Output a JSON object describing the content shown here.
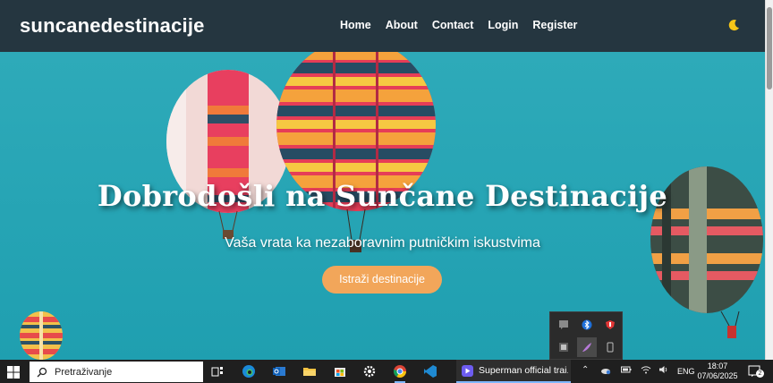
{
  "navbar": {
    "brand": "suncanedestinacije",
    "links": [
      "Home",
      "About",
      "Contact",
      "Login",
      "Register"
    ],
    "theme_icon": "moon-icon"
  },
  "hero": {
    "title": "Dobrodošli na Sunčane Destinacije",
    "subtitle": "Vaša vrata ka nezaboravnim putničkim iskustvima",
    "cta_label": "Istraži destinacije",
    "bg_color": "#2aa7b8",
    "cta_color": "#f2a65a"
  },
  "tray_flyout": {
    "icons": [
      "chat-icon",
      "bluetooth-icon",
      "shield-icon",
      "app-icon",
      "feather-icon",
      "device-icon"
    ]
  },
  "taskbar": {
    "search_placeholder": "Pretraživanje",
    "apps": [
      "task-view-icon",
      "edge-icon",
      "outlook-icon",
      "file-explorer-icon",
      "store-icon",
      "settings-icon",
      "chrome-icon",
      "vscode-icon"
    ],
    "active_task": "Superman official trai...",
    "language": "ENG",
    "time": "18:07",
    "date": "07/06/2025",
    "notification_count": "2"
  }
}
